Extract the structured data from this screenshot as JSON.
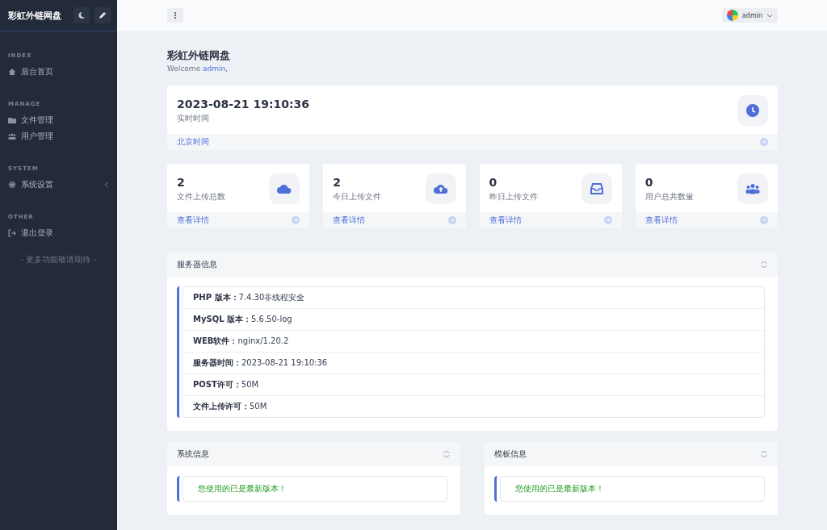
{
  "sidebar": {
    "brand": "彩虹外链网盘",
    "sections": [
      {
        "heading": "INDEX",
        "items": [
          {
            "label": "后台首页",
            "submenu": false
          }
        ]
      },
      {
        "heading": "MANAGE",
        "items": [
          {
            "label": "文件管理",
            "submenu": false
          },
          {
            "label": "用户管理",
            "submenu": false
          }
        ]
      },
      {
        "heading": "SYSTEM",
        "items": [
          {
            "label": "系统设置",
            "submenu": true
          }
        ]
      },
      {
        "heading": "OTHER",
        "items": [
          {
            "label": "退出登录",
            "submenu": false
          }
        ]
      }
    ],
    "footer": "- 更多功能敬请期待 -"
  },
  "header": {
    "user": "admin"
  },
  "page": {
    "title": "彩虹外链网盘",
    "welcome": {
      "prefix": "Welcome",
      "user": "admin",
      "suffix": ","
    }
  },
  "clock_card": {
    "value": "2023-08-21 19:10:36",
    "label": "实时时间",
    "footer": "北京时间"
  },
  "stats": [
    {
      "value": "2",
      "label": "文件上传总数",
      "link": "查看详情"
    },
    {
      "value": "2",
      "label": "今日上传文件",
      "link": "查看详情"
    },
    {
      "value": "0",
      "label": "昨日上传文件",
      "link": "查看详情"
    },
    {
      "value": "0",
      "label": "用户总共数量",
      "link": "查看详情"
    }
  ],
  "server_info": {
    "title": "服务器信息",
    "rows": [
      {
        "label": "PHP 版本：",
        "value": "7.4.30非线程安全"
      },
      {
        "label": "MySQL 版本：",
        "value": "5.6.50-log"
      },
      {
        "label": "WEB软件：",
        "value": "nginx/1.20.2"
      },
      {
        "label": "服务器时间：",
        "value": "2023-08-21 19:10:36"
      },
      {
        "label": "POST许可：",
        "value": "50M"
      },
      {
        "label": "文件上传许可：",
        "value": "50M"
      }
    ]
  },
  "panels": [
    {
      "title": "系统信息",
      "message": "您使用的已是最新版本！"
    },
    {
      "title": "模板信息",
      "message": "您使用的已是最新版本！"
    }
  ]
}
